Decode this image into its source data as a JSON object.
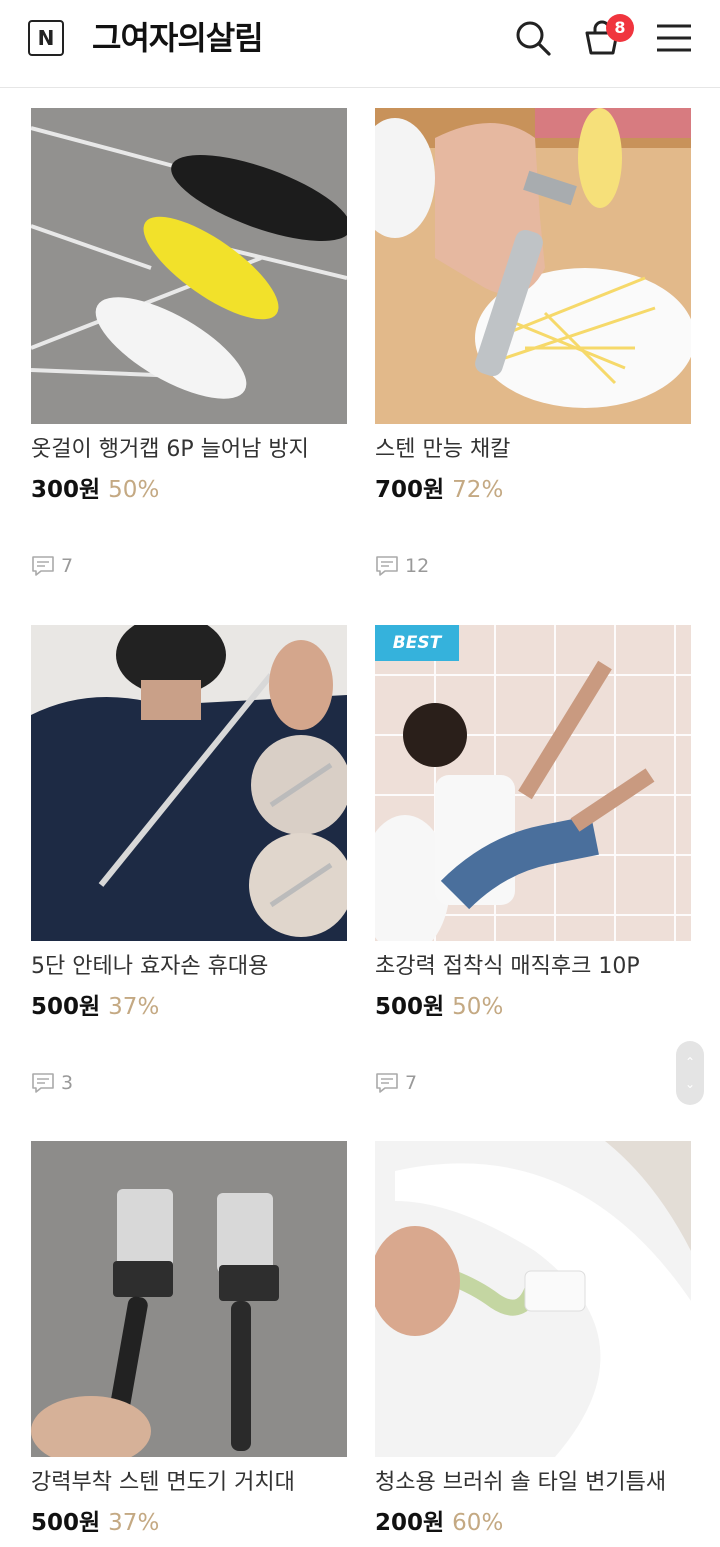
{
  "header": {
    "logo_letter": "N",
    "store_name": "그여자의살림",
    "cart_count": "8"
  },
  "products": [
    {
      "title": "옷걸이 행거캡 6P 늘어남 방지",
      "price": "300원",
      "discount": "50%",
      "reviews": "7"
    },
    {
      "title": "스텐 만능 채칼",
      "price": "700원",
      "discount": "72%",
      "reviews": "12"
    },
    {
      "title": "5단 안테나 효자손 휴대용",
      "price": "500원",
      "discount": "37%",
      "reviews": "3"
    },
    {
      "title": "초강력 접착식 매직후크 10P",
      "price": "500원",
      "discount": "50%",
      "reviews": "7",
      "badge": "BEST"
    },
    {
      "title": "강력부착 스텐 면도기 거치대",
      "price": "500원",
      "discount": "37%"
    },
    {
      "title": "청소용 브러쉬 솔 타일 변기틈새",
      "price": "200원",
      "discount": "60%"
    }
  ],
  "colors": {
    "discount": "#c4a983",
    "badge_best": "#35b2dc",
    "cart_badge": "#f0353e"
  },
  "icons": [
    "logo-icon",
    "search-icon",
    "cart-icon",
    "menu-icon",
    "review-comment-icon",
    "chevron-up-icon",
    "chevron-down-icon"
  ]
}
